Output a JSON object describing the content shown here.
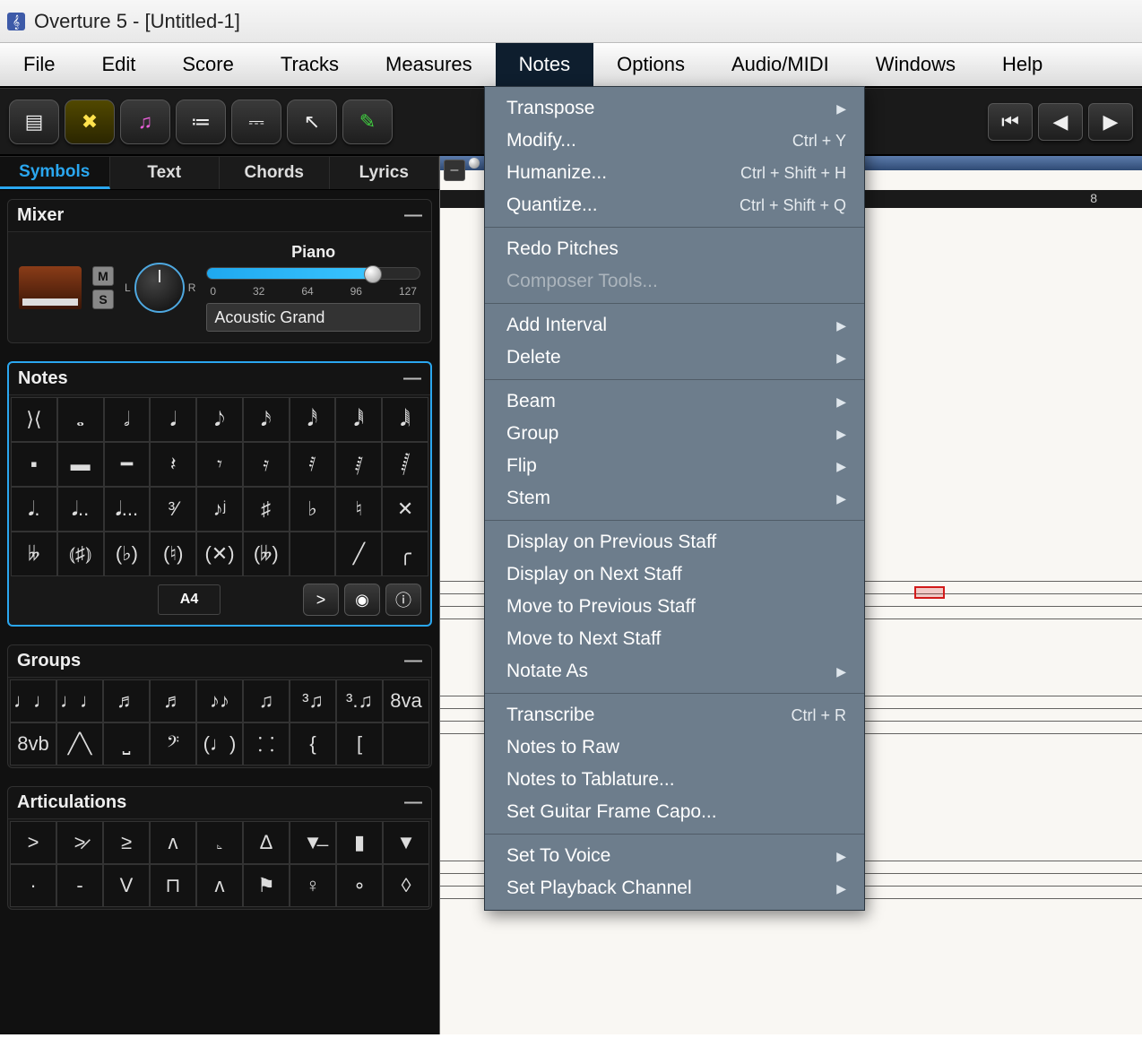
{
  "titlebar": {
    "title": "Overture 5 - [Untitled-1]"
  },
  "menubar": {
    "items": [
      "File",
      "Edit",
      "Score",
      "Tracks",
      "Measures",
      "Notes",
      "Options",
      "Audio/MIDI",
      "Windows",
      "Help"
    ],
    "active_index": 5
  },
  "toolbar": {
    "left": [
      {
        "name": "panel-button",
        "glyph": "▤"
      },
      {
        "name": "tools-button",
        "glyph": "✖"
      },
      {
        "name": "note-entry-button",
        "glyph": "♫"
      },
      {
        "name": "list-button",
        "glyph": "≔"
      },
      {
        "name": "mixer-button",
        "glyph": "⎓"
      },
      {
        "name": "pointer-tool",
        "glyph": "↖"
      },
      {
        "name": "pencil-tool",
        "glyph": "✎"
      }
    ],
    "transport": [
      {
        "name": "skip-back",
        "glyph": "⏮"
      },
      {
        "name": "step-back",
        "glyph": "◀"
      },
      {
        "name": "play",
        "glyph": "▶"
      }
    ]
  },
  "left_tabs": {
    "items": [
      "Symbols",
      "Text",
      "Chords",
      "Lyrics"
    ],
    "active_index": 0
  },
  "mixer": {
    "title": "Mixer",
    "mute_label": "M",
    "solo_label": "S",
    "left_label": "L",
    "right_label": "R",
    "instrument_label": "Piano",
    "ticks": [
      "0",
      "32",
      "64",
      "96",
      "127"
    ],
    "volume_value": 100,
    "preset": "Acoustic Grand"
  },
  "notes_panel": {
    "title": "Notes",
    "row1": [
      "⟩⟨",
      "𝅝",
      "𝅗𝅥",
      "𝅘𝅥",
      "𝅘𝅥𝅮",
      "𝅘𝅥𝅯",
      "𝅘𝅥𝅰",
      "𝅘𝅥𝅱",
      "𝅘𝅥𝅲"
    ],
    "row2": [
      "▪",
      "▬",
      "━",
      "𝄽",
      "𝄾",
      "𝄿",
      "𝅀",
      "𝅁",
      "𝅂"
    ],
    "row3": [
      "𝅘𝅥.",
      "𝅘𝅥..",
      "𝅘𝅥...",
      "³⁄",
      "♪ʲ",
      "♯",
      "♭",
      "♮",
      "✕"
    ],
    "row4": [
      "𝄫",
      "⦅♯⦆",
      "(♭)",
      "(♮)",
      "(✕)",
      "(𝄫)",
      "",
      "╱",
      "╭"
    ],
    "pitch_label": "A4",
    "accent_label": ">",
    "midi_label": "◉",
    "info_label": "ⓘ"
  },
  "groups_panel": {
    "title": "Groups",
    "row1": [
      "♩♩",
      "♩♩",
      "♬",
      "♬",
      "♪♪",
      "♫",
      "³♫",
      "³.♫",
      "8va"
    ],
    "row2": [
      "8vb",
      "╱╲",
      "⎵",
      "𝄢",
      "(♩)",
      "⸬",
      "{",
      "[",
      ""
    ]
  },
  "articulations_panel": {
    "title": "Articulations",
    "row1": [
      ">",
      ">̷",
      "≥",
      "ʌ",
      "𝅊",
      "Δ",
      "▼̶",
      "▮",
      "▼"
    ],
    "row2": [
      "·",
      "-",
      "V",
      "⊓",
      "ʌ",
      "⚑",
      "♀",
      "∘",
      "◊"
    ]
  },
  "ruler": {
    "tick": "8"
  },
  "dropdown": {
    "sections": [
      [
        {
          "label": "Transpose",
          "shortcut": "",
          "submenu": true,
          "disabled": false
        },
        {
          "label": "Modify...",
          "shortcut": "Ctrl + Y",
          "submenu": false,
          "disabled": false
        },
        {
          "label": "Humanize...",
          "shortcut": "Ctrl + Shift + H",
          "submenu": false,
          "disabled": false
        },
        {
          "label": "Quantize...",
          "shortcut": "Ctrl + Shift + Q",
          "submenu": false,
          "disabled": false
        }
      ],
      [
        {
          "label": "Redo Pitches",
          "shortcut": "",
          "submenu": false,
          "disabled": false
        },
        {
          "label": "Composer Tools...",
          "shortcut": "",
          "submenu": false,
          "disabled": true
        }
      ],
      [
        {
          "label": "Add Interval",
          "shortcut": "",
          "submenu": true,
          "disabled": false
        },
        {
          "label": "Delete",
          "shortcut": "",
          "submenu": true,
          "disabled": false
        }
      ],
      [
        {
          "label": "Beam",
          "shortcut": "",
          "submenu": true,
          "disabled": false
        },
        {
          "label": "Group",
          "shortcut": "",
          "submenu": true,
          "disabled": false
        },
        {
          "label": "Flip",
          "shortcut": "",
          "submenu": true,
          "disabled": false
        },
        {
          "label": "Stem",
          "shortcut": "",
          "submenu": true,
          "disabled": false
        }
      ],
      [
        {
          "label": "Display on Previous Staff",
          "shortcut": "",
          "submenu": false,
          "disabled": false
        },
        {
          "label": "Display on Next Staff",
          "shortcut": "",
          "submenu": false,
          "disabled": false
        },
        {
          "label": "Move to Previous Staff",
          "shortcut": "",
          "submenu": false,
          "disabled": false
        },
        {
          "label": "Move to Next Staff",
          "shortcut": "",
          "submenu": false,
          "disabled": false
        },
        {
          "label": "Notate As",
          "shortcut": "",
          "submenu": true,
          "disabled": false
        }
      ],
      [
        {
          "label": "Transcribe",
          "shortcut": "Ctrl + R",
          "submenu": false,
          "disabled": false
        },
        {
          "label": "Notes to Raw",
          "shortcut": "",
          "submenu": false,
          "disabled": false
        },
        {
          "label": "Notes to Tablature...",
          "shortcut": "",
          "submenu": false,
          "disabled": false
        },
        {
          "label": "Set Guitar Frame Capo...",
          "shortcut": "",
          "submenu": false,
          "disabled": false
        }
      ],
      [
        {
          "label": "Set To Voice",
          "shortcut": "",
          "submenu": true,
          "disabled": false
        },
        {
          "label": "Set Playback Channel",
          "shortcut": "",
          "submenu": true,
          "disabled": false
        }
      ]
    ]
  }
}
